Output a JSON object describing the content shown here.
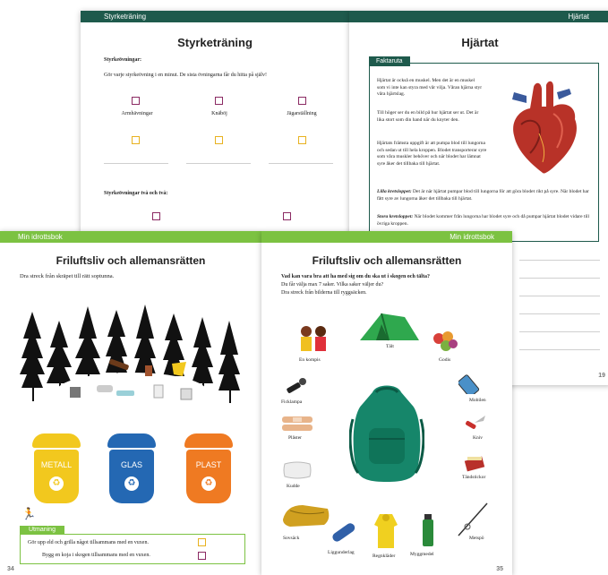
{
  "back_left": {
    "header": "Styrketräning",
    "title": "Styrketräning",
    "section1": "Styrkeövningar:",
    "instruction": "Gör varje styrkeövning i en minut. De sista övningarna får du hitta på själv!",
    "exercises": [
      "Armhävningar",
      "Knäböj",
      "Jägarställning"
    ],
    "section2": "Styrkeövningar två och två:"
  },
  "back_right": {
    "header": "Hjärtat",
    "title": "Hjärtat",
    "box_label": "Faktaruta",
    "p1": "Hjärtat är också en muskel. Men det är en muskel som vi inte kan styra med vår vilja. Våran hjärna styr våra hjärtslag.",
    "p2": "Till höger ser du en bild på hur hjärtat ser ut. Det är lika stort som din hand när du knyter den.",
    "p3": "Hjärtats främsta uppgift är att pumpa blod till lungorna och sedan ut till hela kroppen. Blodet transporterar syre som våra muskler behöver och när blodet har lämnat syre åker det tillbaka till hjärtat.",
    "p4_bold": "Lilla kretsloppet:",
    "p4": "Det är när hjärtat pumpar blod till lungorna för att göra blodet rikt på syre. När blodet har fått syre av lungorna åker det tillbaka till hjärtat.",
    "p5_bold": "Stora kretsloppet:",
    "p5": "När blodet kommer från lungorna har blodet syre och då pumpar hjärtat blodet vidare till övriga kroppen.",
    "page_number": "19"
  },
  "front_left": {
    "header": "Min idrottsbok",
    "title": "Friluftsliv och allemansrätten",
    "instruction": "Dra streck från skräpet till rätt soptunna.",
    "bins": [
      {
        "label": "METALL",
        "color": "#f2c81e"
      },
      {
        "label": "GLAS",
        "color": "#2468b3"
      },
      {
        "label": "PLAST",
        "color": "#ef7a22"
      }
    ],
    "task_label": "Utmaning",
    "tasks": [
      "Gör upp eld och grilla något tillsammans med en vuxen.",
      "Bygg en koja i skogen tillsammans med en vuxen."
    ],
    "page_number": "34"
  },
  "front_right": {
    "header": "Min idrottsbok",
    "title": "Friluftsliv och allemansrätten",
    "question": "Vad kan vara bra att ha med sig om du ska ut i skogen och tälta?",
    "line2": "Du får välja max 7 saker. Vilka saker väljer du?",
    "line3": "Dra streck från bilderna till ryggsäcken.",
    "items": [
      "En kompis",
      "Tält",
      "Godis",
      "Ficklampa",
      "Mobilen",
      "Plåster",
      "Kniv",
      "Tändstickor",
      "Kudde",
      "Sovsäck",
      "Liggunderlag",
      "Regnkläder",
      "Myggmedel",
      "Metspö"
    ],
    "page_number": "35"
  },
  "colors": {
    "dark_green": "#1e5a4c",
    "light_green": "#7cc242",
    "purple": "#8b2a63",
    "yellow": "#e8b220"
  }
}
